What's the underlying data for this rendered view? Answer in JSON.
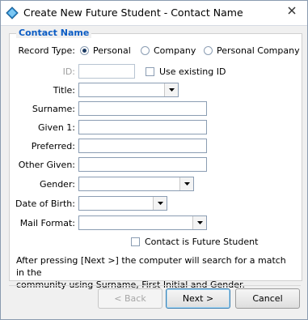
{
  "window": {
    "title": "Create New Future Student - Contact Name"
  },
  "group": {
    "label": "Contact Name"
  },
  "record_type": {
    "label": "Record Type:",
    "options": [
      "Personal",
      "Company",
      "Personal Company"
    ],
    "selected": "Personal"
  },
  "fields": {
    "id_label": "ID:",
    "id_value": "",
    "use_existing_label": "Use existing ID",
    "title_label": "Title:",
    "title_value": "",
    "surname_label": "Surname:",
    "surname_value": "",
    "given1_label": "Given 1:",
    "given1_value": "",
    "preferred_label": "Preferred:",
    "preferred_value": "",
    "other_given_label": "Other Given:",
    "other_given_value": "",
    "gender_label": "Gender:",
    "gender_value": "",
    "dob_label": "Date of Birth:",
    "dob_value": "",
    "mail_format_label": "Mail Format:",
    "mail_format_value": "",
    "contact_future_student_label": "Contact is Future Student"
  },
  "info": {
    "line1": "After pressing [Next >] the computer will search for a match in the",
    "line2": "community using Surname, First Initial and Gender."
  },
  "buttons": {
    "back": "< Back",
    "next": "Next >",
    "cancel": "Cancel"
  },
  "colors": {
    "accent": "#0b5cc4"
  }
}
